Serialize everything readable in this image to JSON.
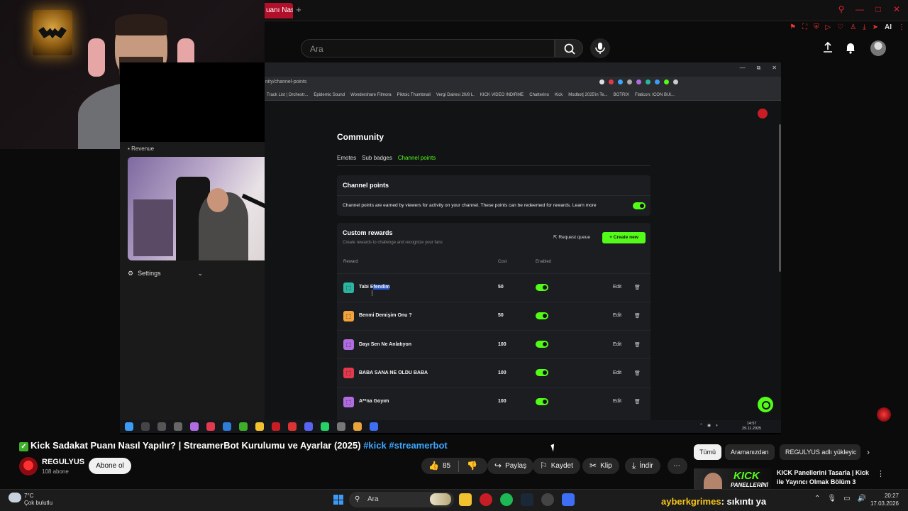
{
  "browser": {
    "tab_label": "uanı Nası",
    "new_tab": "+",
    "window_buttons": [
      "—",
      "□",
      "✕"
    ],
    "ai_label": "AI"
  },
  "youtube": {
    "search_placeholder": "Ara"
  },
  "stream_panel": {
    "revenue_label": "Revenue",
    "settings_label": "Settings"
  },
  "inner_browser": {
    "url": "nity/channel-points",
    "bookmarks": [
      "Track List | Orchestr...",
      "Epidemic Sound",
      "Wondershare Filmora",
      "Piktoic Thumbnail",
      "Vergi Dairesi 20/8 L.",
      "KICK VIDEO INDIRME",
      "Chatterino",
      "Kick",
      "Modbot| 2025'in Te...",
      "BOTRIX",
      "Flaticon: ICON BUI..."
    ]
  },
  "kick": {
    "page_title": "Community",
    "tabs": [
      "Emotes",
      "Sub badges",
      "Channel points"
    ],
    "channel_points": {
      "title": "Channel points",
      "description": "Channel points are earned by viewers for activity on your channel. These points can be redeemed for rewards. Learn more",
      "enabled": true
    },
    "custom_rewards": {
      "title": "Custom rewards",
      "subtitle": "Create rewards to challenge and recognize your fans",
      "request_queue": "Request queue",
      "create_new": "Create new",
      "headers": {
        "reward": "Reward",
        "cost": "Cost",
        "enabled": "Enabled"
      },
      "rewards": [
        {
          "name_a": "Tabi E",
          "name_b": "fendim",
          "cost": "50",
          "edit": "Edit",
          "color": "#2bb5a0"
        },
        {
          "name_a": "Benmi Demişim Onu ?",
          "name_b": "",
          "cost": "50",
          "edit": "Edit",
          "color": "#f2a23a"
        },
        {
          "name_a": "Dayı Sen Ne Anlatıyon",
          "name_b": "",
          "cost": "100",
          "edit": "Edit",
          "color": "#b06ce0"
        },
        {
          "name_a": "BABA SANA NE OLDU BABA",
          "name_b": "",
          "cost": "100",
          "edit": "Edit",
          "color": "#e2394e"
        },
        {
          "name_a": "A**na Goyım",
          "name_b": "",
          "cost": "100",
          "edit": "Edit",
          "color": "#b06ce0"
        }
      ]
    }
  },
  "inner_taskbar": {
    "time": "14:57",
    "date": "29.11.2025"
  },
  "video": {
    "title_main": "Kick Sadakat Puanı Nasıl Yapılır? | StreamerBot Kurulumu ve Ayarlar (2025)",
    "tag1": "#kick",
    "tag2": "#streamerbot",
    "channel_name": "REGULYUS",
    "subscribers": "108 abone",
    "subscribe_label": "Abone ol",
    "likes": "85",
    "share_label": "Paylaş",
    "save_label": "Kaydet",
    "clip_label": "Klip",
    "download_label": "İndir"
  },
  "chips": [
    "Tümü",
    "Aramanızdan",
    "REGULYUS adlı yükleyic"
  ],
  "recommendation": {
    "thumb_text": "KICK",
    "thumb_sub": "PANELLERİNİ",
    "title": "KICK Panellerini Tasarla | Kick ile Yayıncı Olmak Bölüm 3"
  },
  "taskbar": {
    "temp": "7°C",
    "weather": "Çok bulutlu",
    "search_label": "Ara",
    "chat_user": "ayberkgrimes",
    "chat_text": ": sıkıntı ya",
    "time": "20:27",
    "date": "17.03.2026"
  },
  "colors": {
    "kick_green": "#53fc18",
    "youtube_bg": "#0f0f0f",
    "brand_red": "#c81d25"
  }
}
